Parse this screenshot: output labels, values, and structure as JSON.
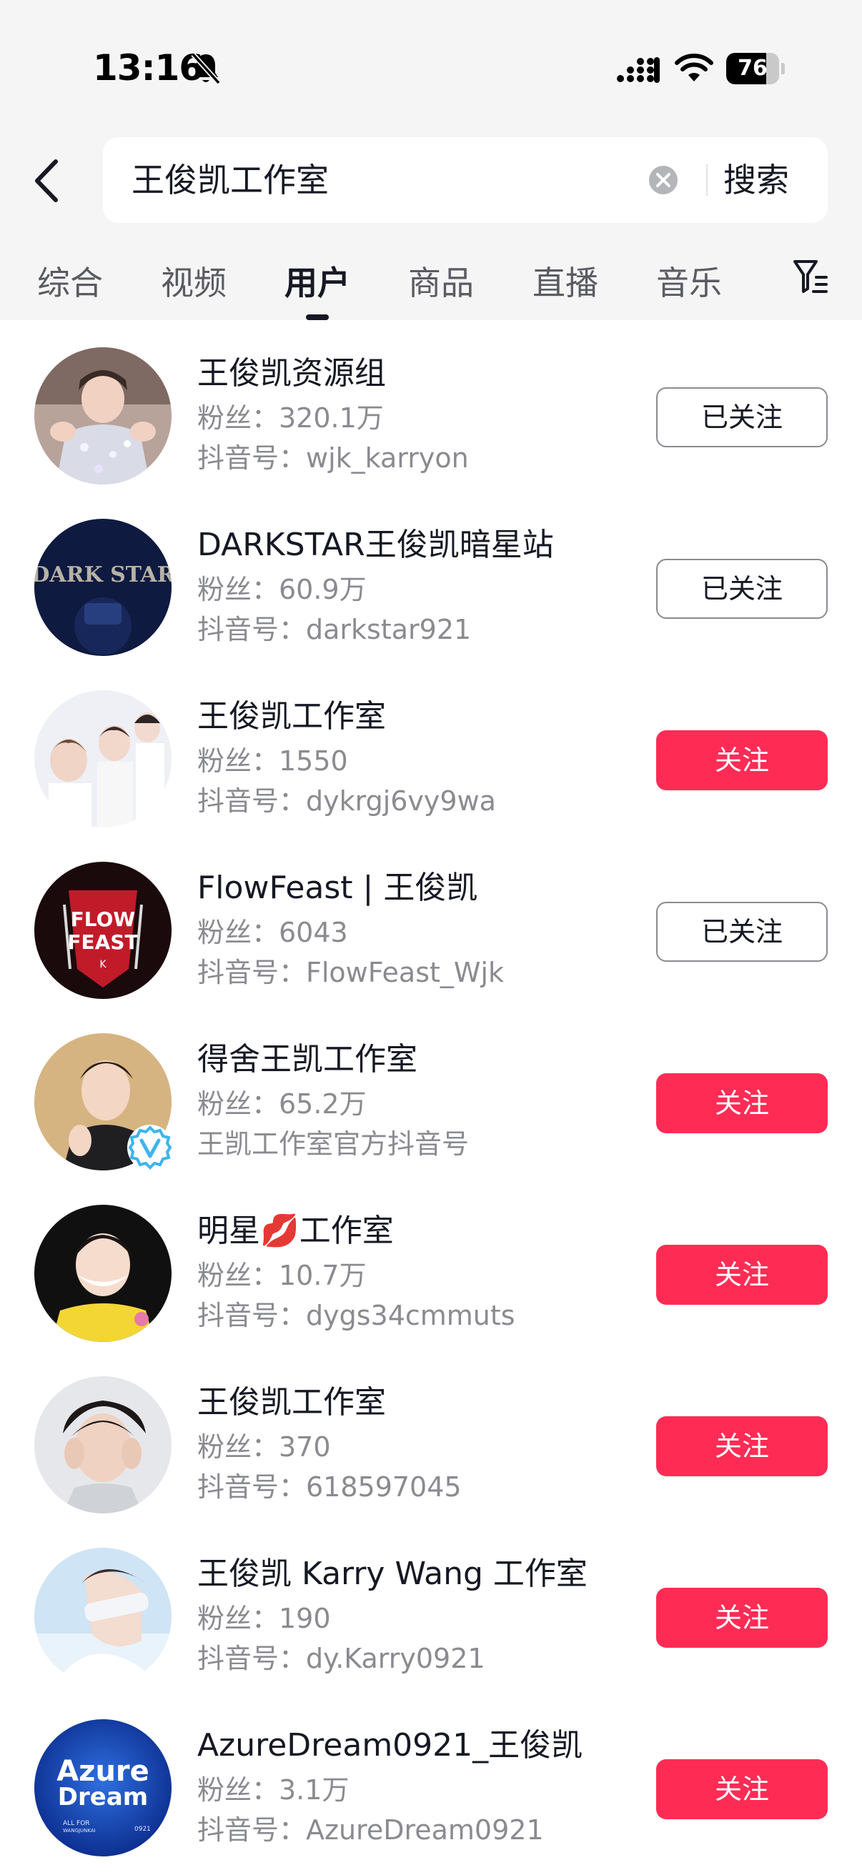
{
  "status_bar": {
    "time": "13:16",
    "battery_level": 76,
    "battery_text": "76",
    "icons": [
      "bell-off-icon",
      "signal-icon",
      "wifi-icon",
      "battery-icon"
    ]
  },
  "search": {
    "query": "王俊凯工作室",
    "button_label": "搜索"
  },
  "tabs": [
    {
      "label": "综合",
      "active": false
    },
    {
      "label": "视频",
      "active": false
    },
    {
      "label": "用户",
      "active": true
    },
    {
      "label": "商品",
      "active": false
    },
    {
      "label": "直播",
      "active": false
    },
    {
      "label": "音乐",
      "active": false
    }
  ],
  "colors": {
    "accent": "#fe2c55",
    "header_bg": "#f5f5f5",
    "secondary_text": "#8a8b91"
  },
  "users": [
    {
      "name": "王俊凯资源组",
      "fans": "粉丝：320.1万",
      "sub": "抖音号：wjk_karryon",
      "follow_label": "已关注",
      "followed": true
    },
    {
      "name": "DARKSTAR王俊凯暗星站",
      "fans": "粉丝：60.9万",
      "sub": "抖音号：darkstar921",
      "follow_label": "已关注",
      "followed": true
    },
    {
      "name": "王俊凯工作室",
      "fans": "粉丝：1550",
      "sub": "抖音号：dykrgj6vy9wa",
      "follow_label": "关注",
      "followed": false
    },
    {
      "name": "FlowFeast | 王俊凯",
      "fans": "粉丝：6043",
      "sub": "抖音号：FlowFeast_Wjk",
      "follow_label": "已关注",
      "followed": true
    },
    {
      "name": "得舍王凯工作室",
      "fans": "粉丝：65.2万",
      "sub": "王凯工作室官方抖音号",
      "follow_label": "关注",
      "followed": false,
      "verified": true
    },
    {
      "name": "明星💋工作室",
      "fans": "粉丝：10.7万",
      "sub": "抖音号：dygs34cmmuts",
      "follow_label": "关注",
      "followed": false
    },
    {
      "name": "王俊凯工作室",
      "fans": "粉丝：370",
      "sub": "抖音号：618597045",
      "follow_label": "关注",
      "followed": false
    },
    {
      "name": "王俊凯 Karry Wang 工作室",
      "fans": "粉丝：190",
      "sub": "抖音号：dy.Karry0921",
      "follow_label": "关注",
      "followed": false
    },
    {
      "name": "AzureDream0921_王俊凯",
      "fans": "粉丝：3.1万",
      "sub": "抖音号：AzureDream0921",
      "follow_label": "关注",
      "followed": false
    }
  ],
  "avatar_texts": {
    "darkstar": "DARK STAR",
    "flowfeast_line1": "FLOW",
    "flowfeast_line2": "FEAST",
    "flowfeast_line3": "K",
    "azure_line1": "Azure",
    "azure_line2": "Dream",
    "azure_line3": "ALL FOR",
    "azure_line4": "WANGJUNKAI",
    "azure_line5": "0921"
  }
}
